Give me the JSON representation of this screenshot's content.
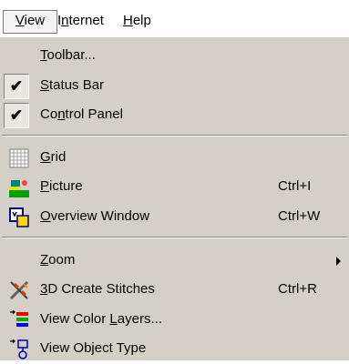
{
  "menubar": {
    "view": {
      "accel": "V",
      "rest": "iew"
    },
    "internet": {
      "pre": "I",
      "accel": "n",
      "rest": "ternet"
    },
    "help": {
      "accel": "H",
      "rest": "elp"
    }
  },
  "menu": {
    "toolbar": {
      "accel": "T",
      "rest": "oolbar..."
    },
    "status_bar": {
      "accel": "S",
      "rest": "tatus Bar",
      "checked": true
    },
    "control_panel": {
      "pre": "Co",
      "accel": "n",
      "rest": "trol Panel",
      "checked": true
    },
    "grid": {
      "accel": "G",
      "rest": "rid"
    },
    "picture": {
      "accel": "P",
      "rest": "icture",
      "shortcut": "Ctrl+I"
    },
    "overview": {
      "accel": "O",
      "rest": "verview Window",
      "shortcut": "Ctrl+W"
    },
    "zoom": {
      "accel": "Z",
      "rest": "oom"
    },
    "stitches": {
      "accel": "3",
      "rest": "D Create Stitches",
      "shortcut": "Ctrl+R"
    },
    "color_layers": {
      "pre": "View Color ",
      "accel": "L",
      "rest": "ayers..."
    },
    "object_type": {
      "pre": "View Ob",
      "accel": "j",
      "rest": "ect Type"
    }
  },
  "colors": {
    "menu_bg": "#d4d0c8",
    "check": "#000000"
  },
  "icons": [
    "checkmark-icon",
    "grid-icon",
    "picture-icon",
    "overview-window-icon",
    "submenu-arrow-icon",
    "3d-stitches-icon",
    "color-layers-icon",
    "object-type-icon"
  ]
}
